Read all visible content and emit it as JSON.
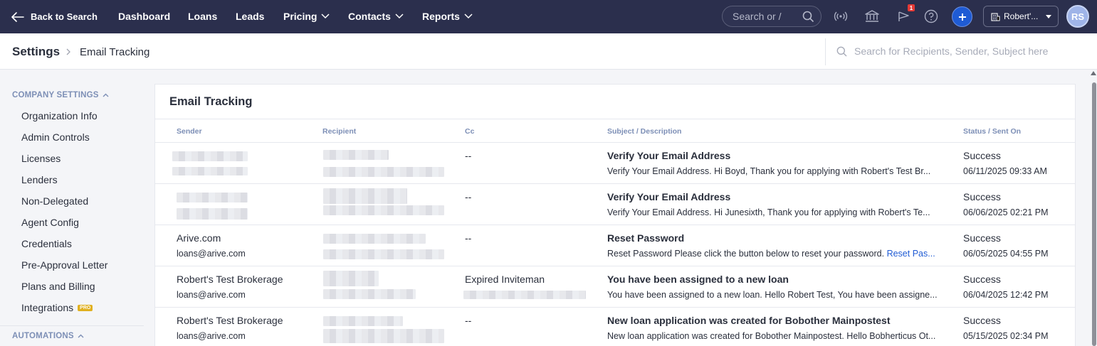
{
  "topnav": {
    "back_label": "Back to Search",
    "items": [
      "Dashboard",
      "Loans",
      "Leads",
      "Pricing",
      "Contacts",
      "Reports"
    ],
    "search_placeholder": "Search or /",
    "notification_count": "1",
    "org_name": "Robert'...",
    "avatar_initials": "RS"
  },
  "breadcrumb": {
    "root": "Settings",
    "current": "Email Tracking",
    "search_placeholder": "Search for Recipients, Sender, Subject here"
  },
  "sidebar": {
    "section_company": "COMPANY SETTINGS",
    "items": [
      "Organization Info",
      "Admin Controls",
      "Licenses",
      "Lenders",
      "Non-Delegated",
      "Agent Config",
      "Credentials",
      "Pre-Approval Letter",
      "Plans and Billing",
      "Integrations"
    ],
    "pro_badge": "PRO",
    "section_automations": "AUTOMATIONS"
  },
  "table": {
    "title": "Email Tracking",
    "headers": {
      "sender": "Sender",
      "recipient": "Recipient",
      "cc": "Cc",
      "subject": "Subject / Description",
      "status": "Status / Sent On"
    },
    "rows": [
      {
        "sender_name": "",
        "sender_email": "",
        "cc": "--",
        "subject": "Verify Your Email Address",
        "description": "Verify Your Email Address. Hi Boyd, Thank you for applying with Robert's Test Br...",
        "status": "Success",
        "sent_on": "06/11/2025 09:33 AM"
      },
      {
        "sender_name": "",
        "sender_email": "",
        "cc": "--",
        "subject": "Verify Your Email Address",
        "description": "Verify Your Email Address. Hi Junesixth, Thank you for applying with Robert's Te...",
        "status": "Success",
        "sent_on": "06/06/2025 02:21 PM"
      },
      {
        "sender_name": "Arive.com",
        "sender_email": "loans@arive.com",
        "cc": "--",
        "subject": "Reset Password",
        "description": "Reset Password Please click the button below to reset your password.",
        "description_link": "Reset Pas...",
        "status": "Success",
        "sent_on": "06/05/2025 04:55 PM"
      },
      {
        "sender_name": "Robert's Test Brokerage",
        "sender_email": "loans@arive.com",
        "cc": "Expired Inviteman",
        "subject": "You have been assigned to a new loan",
        "description": "You have been assigned to a new loan. Hello Robert Test, You have been assigne...",
        "status": "Success",
        "sent_on": "06/04/2025 12:42 PM"
      },
      {
        "sender_name": "Robert's Test Brokerage",
        "sender_email": "loans@arive.com",
        "cc": "--",
        "subject": "New loan application was created for Bobother Mainpostest",
        "description": "New loan application was created for Bobother Mainpostest. Hello Bobherticus Ot...",
        "status": "Success",
        "sent_on": "05/15/2025 02:34 PM"
      }
    ]
  }
}
